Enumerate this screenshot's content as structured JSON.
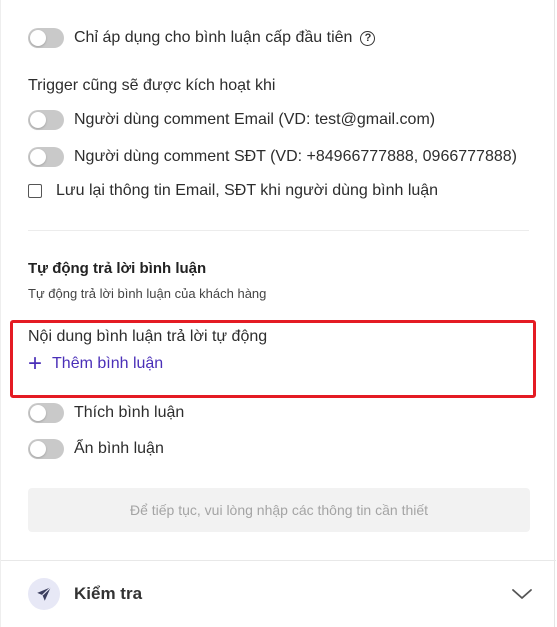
{
  "options": {
    "first_level_only": "Chỉ áp dụng cho bình luận cấp đầu tiên",
    "help_glyph": "?",
    "trigger_heading": "Trigger cũng sẽ được kích hoạt khi",
    "email_comment": "Người dùng comment Email (VD: test@gmail.com)",
    "phone_comment": "Người dùng comment SĐT (VD: +84966777888, 0966777888)",
    "save_info": "Lưu lại thông tin Email, SĐT khi người dùng bình luận"
  },
  "auto_reply": {
    "title": "Tự động trả lời bình luận",
    "subtitle": "Tự động trả lời bình luận của khách hàng",
    "content_label": "Nội dung bình luận trả lời tự động",
    "add_plus": "+",
    "add_label": "Thêm bình luận"
  },
  "actions": {
    "like": "Thích bình luận",
    "hide": "Ẩn bình luận"
  },
  "continue_hint": "Để tiếp tục, vui lòng nhập các thông tin cần thiết",
  "footer": {
    "label": "Kiểm tra"
  },
  "colors": {
    "highlight": "#e41b23",
    "accent": "#4a2fb8",
    "toggle_off": "#c9c9c9"
  },
  "icons": {
    "help": "help-circle-icon",
    "send": "send-icon",
    "chevron": "chevron-down-icon"
  }
}
